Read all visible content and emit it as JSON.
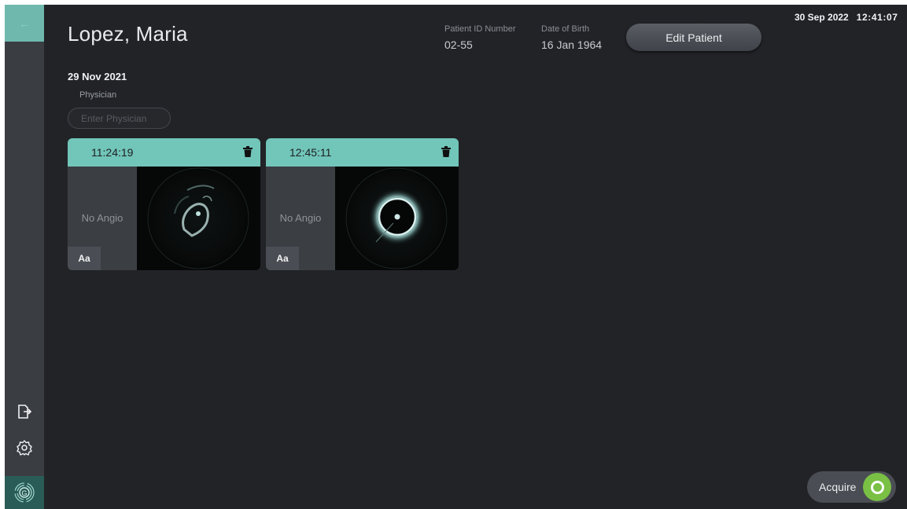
{
  "header": {
    "patient_name": "Lopez, Maria",
    "patient_id_label": "Patient ID Number",
    "patient_id": "02-55",
    "dob_label": "Date of Birth",
    "dob": "16 Jan 1964",
    "edit_patient_label": "Edit Patient",
    "date": "30 Sep 2022",
    "time": "12:41:07"
  },
  "session": {
    "date": "29 Nov 2021",
    "physician_label": "Physician",
    "physician_placeholder": "Enter Physician",
    "physician_value": ""
  },
  "recordings": [
    {
      "time": "11:24:19",
      "angio_text": "No Angio",
      "annotation_label": "Aa"
    },
    {
      "time": "12:45:11",
      "angio_text": "No Angio",
      "annotation_label": "Aa"
    }
  ],
  "sidebar": {
    "icons": [
      "back-arrow-icon",
      "export-icon",
      "gear-icon",
      "gentuity-logo"
    ]
  },
  "acquire": {
    "label": "Acquire"
  },
  "colors": {
    "accent_teal": "#71c5b9",
    "background": "#212327",
    "sidebar": "#3a3d42",
    "acquire_green": "#79c044"
  }
}
